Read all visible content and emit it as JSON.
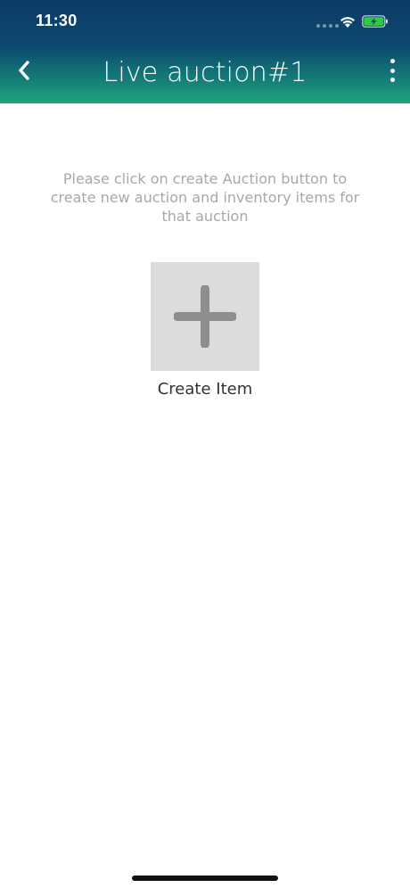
{
  "status_bar": {
    "time": "11:30",
    "wifi_icon": "wifi-icon",
    "battery_icon": "battery-charging-icon",
    "battery_color": "#2ecc40"
  },
  "header": {
    "title": "Live auction#1",
    "back_icon": "chevron-left-icon",
    "more_icon": "vertical-ellipsis-icon",
    "gradient_top": "#0b3a68",
    "gradient_bottom": "#21a37b"
  },
  "main": {
    "instruction": "Please click on create Auction button to create new auction and inventory items for that auction",
    "create_item": {
      "icon": "plus-icon",
      "label": "Create Item"
    }
  }
}
